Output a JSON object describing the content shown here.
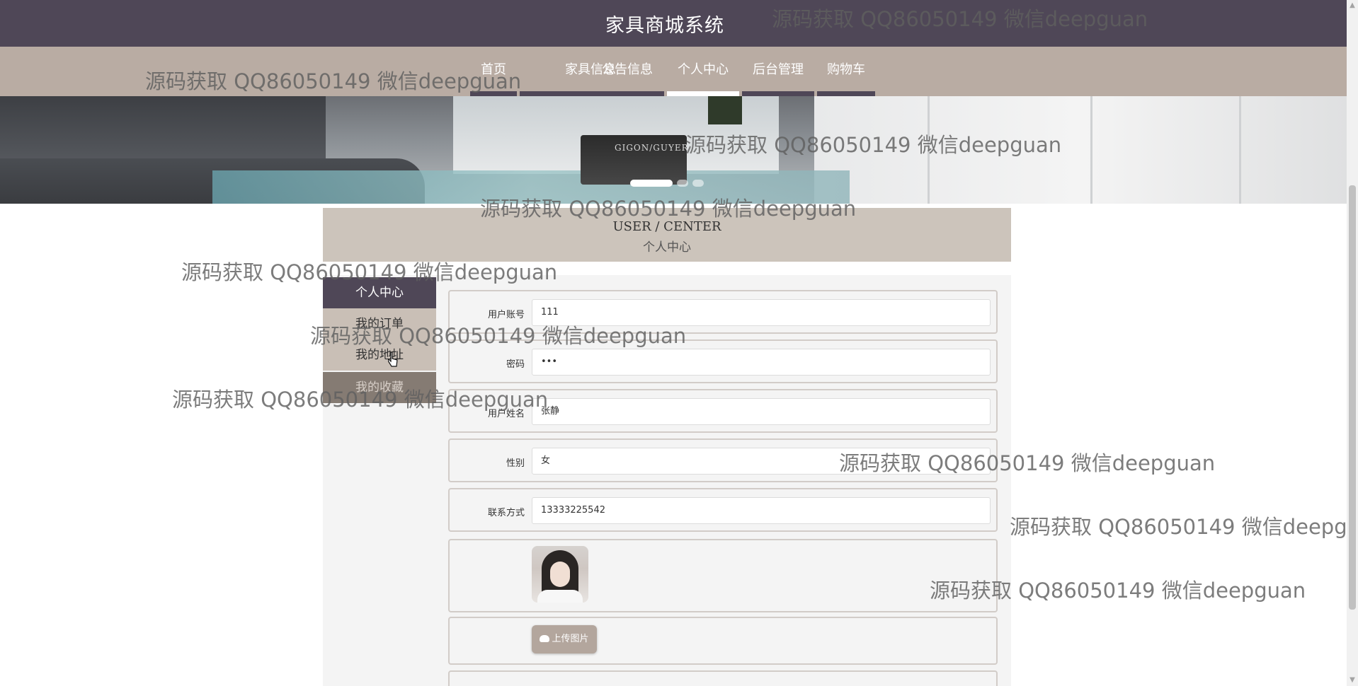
{
  "header": {
    "site_title": "家具商城系统"
  },
  "nav": {
    "items": [
      {
        "label": "首页"
      },
      {
        "label": "家具信息"
      },
      {
        "label": "公告信息"
      },
      {
        "label": "个人中心",
        "active": true
      },
      {
        "label": "后台管理"
      },
      {
        "label": "购物车"
      }
    ]
  },
  "banner": {
    "book_text": "GIGON/GUYER",
    "slide_count": 3,
    "active_slide": 1
  },
  "section": {
    "title_en": "USER / CENTER",
    "title_cn": "个人中心"
  },
  "sidebar": {
    "items": [
      {
        "label": "个人中心"
      },
      {
        "label": "我的订单"
      },
      {
        "label": "我的地址"
      },
      {
        "label": "我的收藏"
      }
    ]
  },
  "form": {
    "username": {
      "label": "用户账号",
      "value": "111"
    },
    "password": {
      "label": "密码",
      "value": "•••"
    },
    "name": {
      "label": "用户姓名",
      "value": "张静"
    },
    "gender": {
      "label": "性别",
      "value": "女"
    },
    "phone": {
      "label": "联系方式",
      "value": "13333225542"
    },
    "upload_label": "上传图片"
  },
  "watermark": "源码获取 QQ86050149 微信deepguan",
  "colors": {
    "header": "#4f4757",
    "nav": "#b9aca3",
    "section": "#ccc4bb",
    "button": "#b3a69d"
  }
}
